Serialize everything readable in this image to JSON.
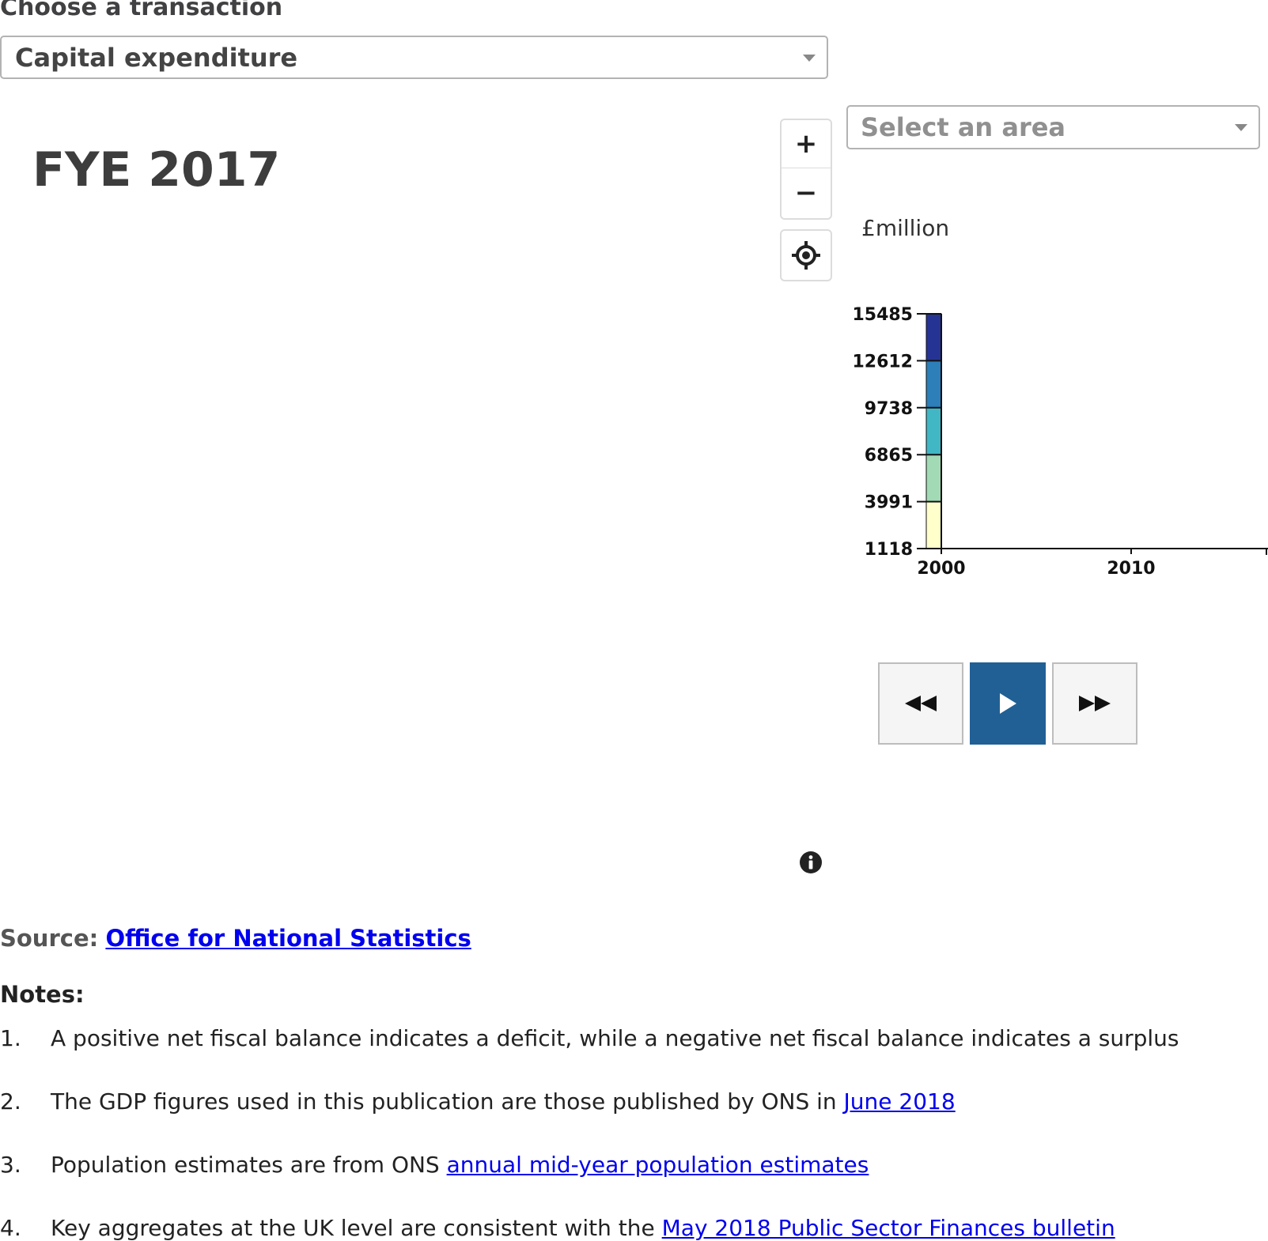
{
  "transaction": {
    "label": "Choose a transaction",
    "selected": "Capital expenditure"
  },
  "map": {
    "year_title": "FYE 2017",
    "zoom_in": "+",
    "zoom_out": "−"
  },
  "area_select": {
    "placeholder": "Select an area"
  },
  "unit_label": "£million",
  "chart_data": {
    "type": "bar",
    "ylabel": "£million",
    "y_ticks": [
      15485,
      12612,
      9738,
      6865,
      3991,
      1118
    ],
    "ylim": [
      1118,
      15485
    ],
    "x_ticks": [
      2000,
      2010
    ],
    "legend_bins": [
      {
        "from": 1118,
        "to": 3991,
        "color": "#ffffcc"
      },
      {
        "from": 3991,
        "to": 6865,
        "color": "#a1dab4"
      },
      {
        "from": 6865,
        "to": 9738,
        "color": "#41b6c4"
      },
      {
        "from": 9738,
        "to": 12612,
        "color": "#2c7fb8"
      },
      {
        "from": 12612,
        "to": 15485,
        "color": "#253494"
      }
    ]
  },
  "player": {
    "rewind_icon": "rewind-icon",
    "play_icon": "play-icon",
    "forward_icon": "fast-forward-icon",
    "accent": "#206095"
  },
  "source": {
    "label": "Source:",
    "link_text": "Office for National Statistics"
  },
  "notes": {
    "title": "Notes:",
    "items": [
      {
        "num": "1.",
        "text": "A positive net fiscal balance indicates a deficit, while a negative net fiscal balance indicates a surplus",
        "link": ""
      },
      {
        "num": "2.",
        "text": "The GDP figures used in this publication are those published by ONS in ",
        "link": "June 2018"
      },
      {
        "num": "3.",
        "text": "Population estimates are from ONS ",
        "link": "annual mid-year population estimates"
      },
      {
        "num": "4.",
        "text": "Key aggregates at the UK level are consistent with the ",
        "link": "May 2018 Public Sector Finances bulletin"
      }
    ]
  }
}
